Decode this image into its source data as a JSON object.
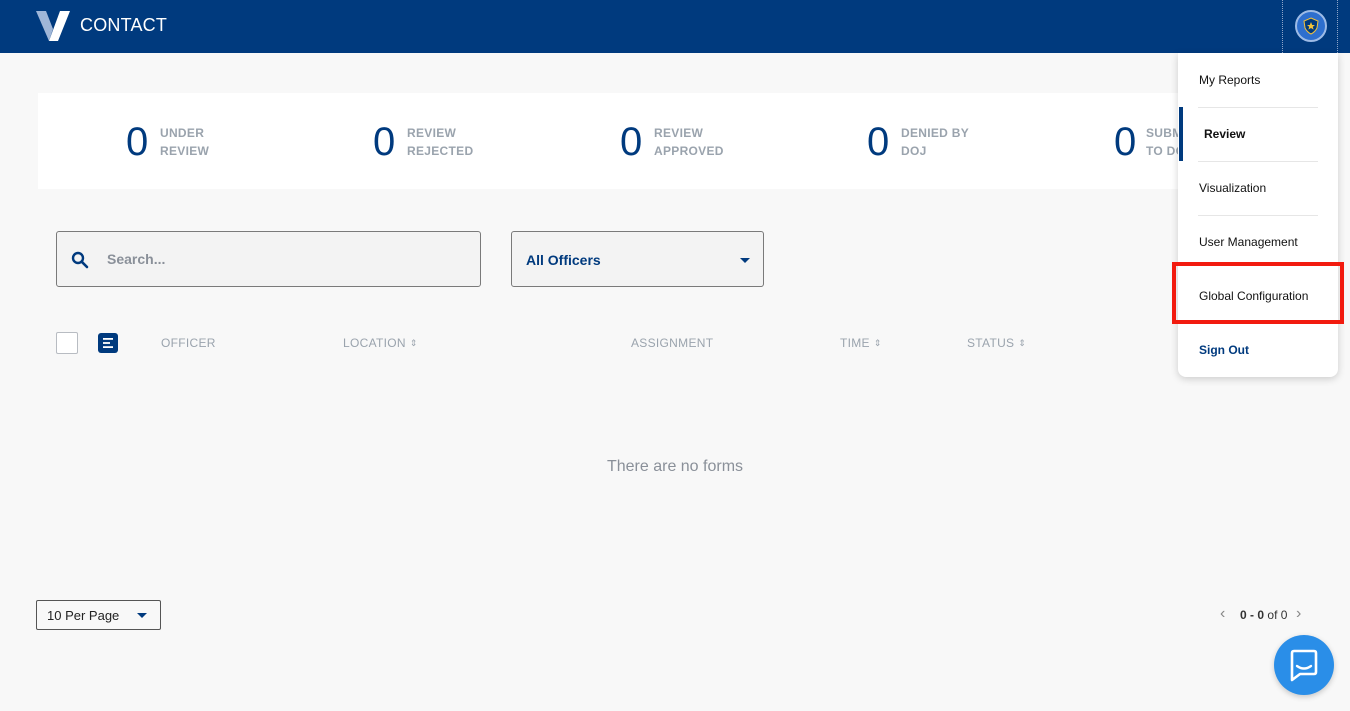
{
  "header": {
    "app_title": "CONTACT"
  },
  "stats": [
    {
      "count": "0",
      "line1": "UNDER",
      "line2": "REVIEW"
    },
    {
      "count": "0",
      "line1": "REVIEW",
      "line2": "REJECTED"
    },
    {
      "count": "0",
      "line1": "REVIEW",
      "line2": "APPROVED"
    },
    {
      "count": "0",
      "line1": "DENIED BY",
      "line2": "DOJ"
    },
    {
      "count": "0",
      "line1": "SUBM",
      "line2": "TO DO"
    }
  ],
  "search": {
    "placeholder": "Search..."
  },
  "officer_filter": {
    "selected": "All Officers"
  },
  "table": {
    "columns": [
      "OFFICER",
      "LOCATION",
      "ASSIGNMENT",
      "TIME",
      "STATUS"
    ],
    "empty_message": "There are no forms"
  },
  "pagination": {
    "per_page": "10 Per Page",
    "range_start": "0",
    "range_end": "0",
    "of_label": "of",
    "total": "0"
  },
  "menu": {
    "items": [
      {
        "label": "My Reports"
      },
      {
        "label": "Review"
      },
      {
        "label": "Visualization"
      },
      {
        "label": "User Management"
      },
      {
        "label": "Global Configuration"
      },
      {
        "label": "Sign Out"
      }
    ]
  },
  "colors": {
    "brand": "#003a7e",
    "highlight": "#f21b0f",
    "chat": "#2a8ee8"
  }
}
